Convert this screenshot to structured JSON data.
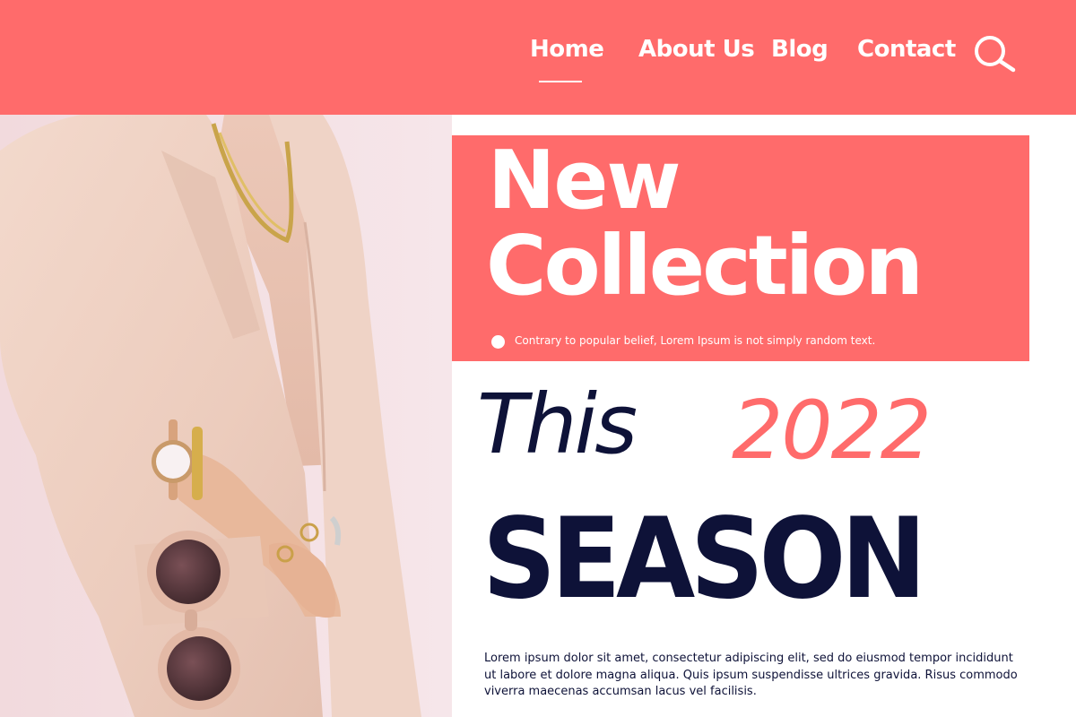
{
  "nav": {
    "items": [
      {
        "label": "Home",
        "active": true
      },
      {
        "label": "About Us"
      },
      {
        "label": "Blog"
      },
      {
        "label": "Contact"
      }
    ],
    "search_icon": "search-icon"
  },
  "promo": {
    "line1": "New",
    "line2": "Collection",
    "caption": "Contrary to popular belief, Lorem Ipsum is not simply random text."
  },
  "headline": {
    "this": "This",
    "year": "2022",
    "season": "SEASON"
  },
  "body_text": "Lorem ipsum dolor sit amet, consectetur adipiscing elit, sed do eiusmod tempor incididunt ut labore et dolore magna aliqua. Quis ipsum suspendisse ultrices gravida. Risus commodo viverra maecenas accumsan lacus vel facilisis.",
  "colors": {
    "accent": "#ff6b6b",
    "navy": "#0e1238",
    "white": "#ffffff"
  }
}
